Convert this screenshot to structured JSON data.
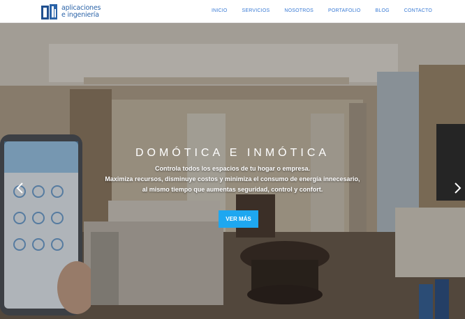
{
  "logo": {
    "line1": "aplicaciones",
    "line2": "e ingeniería"
  },
  "nav": [
    {
      "label": "INICIO"
    },
    {
      "label": "SERVICIOS"
    },
    {
      "label": "NOSOTROS"
    },
    {
      "label": "PORTAFOLIO"
    },
    {
      "label": "BLOG"
    },
    {
      "label": "CONTACTO"
    }
  ],
  "hero": {
    "title": "DOMÓTICA E INMÓTICA",
    "line1": "Controla todos los espacios de tu hogar o empresa.",
    "line2": "Maximiza recursos, disminuye costos y minimiza el consumo de energía innecesario,",
    "line3": "al mismo tiempo que aumentas seguridad, control y confort.",
    "button": "VER MÁS"
  },
  "colors": {
    "nav_link": "#3a7bd5",
    "button": "#1ea7f0",
    "brand": "#2a63a8"
  },
  "icons": [
    "previous-slide-icon",
    "next-slide-icon",
    "smartphone-icon"
  ]
}
